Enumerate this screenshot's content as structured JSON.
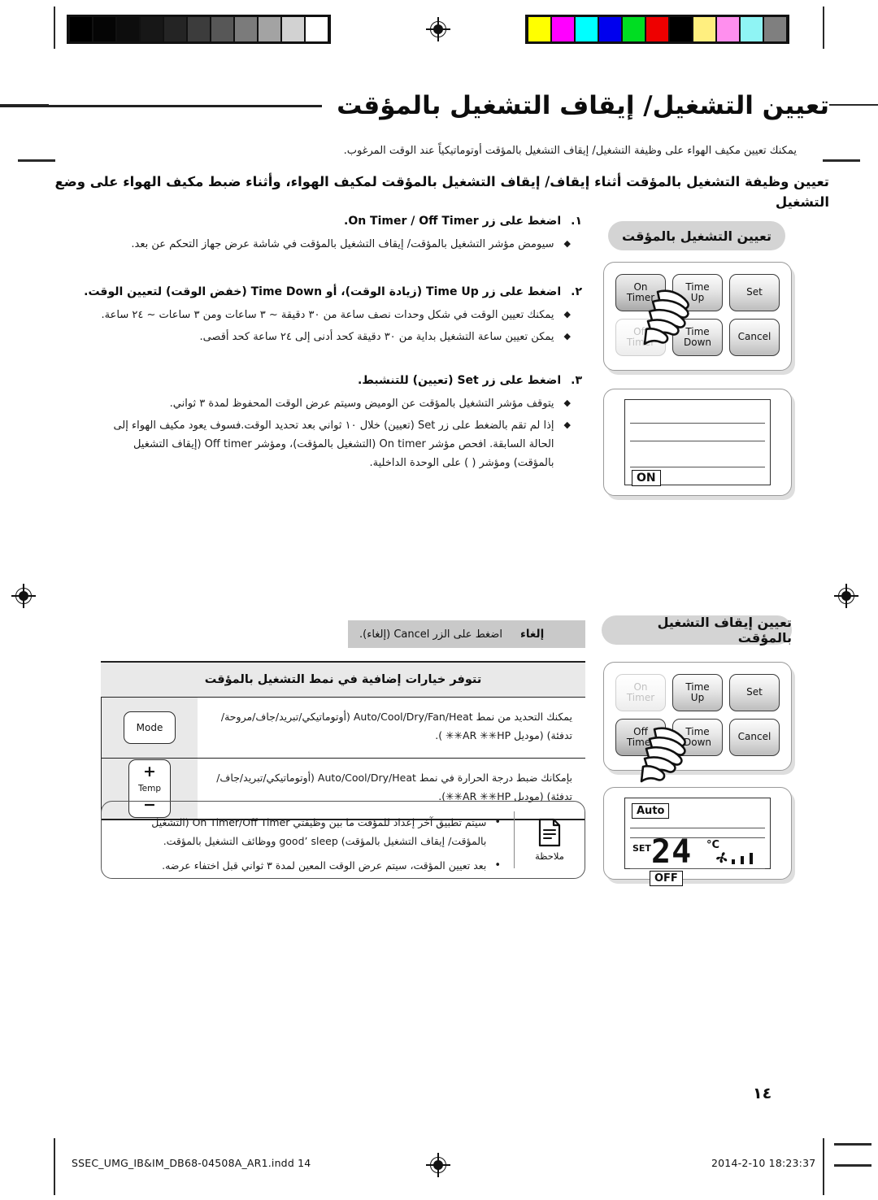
{
  "print_marks": {
    "grayscale_swatches": [
      "#000000",
      "#050505",
      "#0d0d0d",
      "#171717",
      "#242424",
      "#3c3c3c",
      "#575757",
      "#7b7b7b",
      "#a3a3a3",
      "#d2d2d2",
      "#ffffff"
    ],
    "color_swatches": [
      "#ffff00",
      "#ff00ff",
      "#00ffff",
      "#0000ee",
      "#00dd22",
      "#ee0000",
      "#000000",
      "#ffef7f",
      "#ff8fee",
      "#8ff4f4",
      "#7f7f7f"
    ],
    "registration_icon": "registration-target-icon"
  },
  "header": {
    "title": "تعيين التشغيل/ إيقاف التشغيل بالمؤقت",
    "lede": "يمكنك تعيين مكيف الهواء على وظيفة التشغيل/ إيقاف التشغيل بالمؤقت أوتوماتيكياً عند الوقت المرغوب.",
    "subhead": "تعيين وظيفة التشغيل بالمؤقت أثناء إيقاف/ إيقاف التشغيل بالمؤقت لمكيف الهواء، وأثناء ضبط مكيف الهواء على وضع التشغيل"
  },
  "steps": [
    {
      "num": "١.",
      "title_pre": "اضغط على زر ",
      "title_en": "On Timer / Off Timer",
      "title_post": ".",
      "bullets": [
        {
          "mark": "◆",
          "text": "سيومض مؤشر التشغيل بالمؤقت/ إيقاف التشغيل بالمؤقت في شاشة عرض جهاز التحكم عن بعد."
        }
      ]
    },
    {
      "num": "٢.",
      "title_full": "اضغط على زر Time Up (زيادة الوقت)، أو Time Down (خفض الوقت) لتعيين الوقت.",
      "bullets": [
        {
          "mark": "◆",
          "text": "يمكنك تعيين الوقت في شكل وحدات نصف ساعة من ٣٠ دقيقة ~ ٣ ساعات ومن ٣ ساعات ~ ٢٤ ساعة."
        },
        {
          "mark": "◆",
          "text": "يمكن تعيين ساعة التشغيل بداية من ٣٠ دقيقة كحد أدنى إلى ٢٤ ساعة كحد أقصى."
        }
      ]
    },
    {
      "num": "٣.",
      "title_full": "اضغط على زر Set (تعيين) للتنشبط.",
      "bullets": [
        {
          "mark": "◆",
          "text": "يتوقف مؤشر التشغيل بالمؤقت عن الوميض وسيتم عرض الوقت المحفوظ لمدة ٣ ثواني."
        },
        {
          "mark": "◆",
          "text": "إذا لم تقم بالضغط على زر Set (تعيين) خلال ١٠ ثواني بعد تحديد الوقت.فسوف يعود مكيف الهواء إلى الحالة السابقة. افحص مؤشر On timer (التشغيل بالمؤقت)، ومؤشر Off timer (إيقاف التشغيل بالمؤقت) ومؤشر ( ) على الوحدة الداخلية."
        }
      ]
    }
  ],
  "panels": [
    {
      "heading": "تعيين التشغيل بالمؤقت",
      "keys": [
        {
          "name": "on-timer",
          "line1": "On",
          "line2": "Timer",
          "state": "pressed"
        },
        {
          "name": "time-up",
          "line1": "Time",
          "line2": "Up",
          "state": "normal"
        },
        {
          "name": "set",
          "line1": "Set",
          "line2": "",
          "state": "normal"
        },
        {
          "name": "off-timer",
          "line1": "Off",
          "line2": "Timer",
          "state": "disabled"
        },
        {
          "name": "time-down",
          "line1": "Time",
          "line2": "Down",
          "state": "normal"
        },
        {
          "name": "cancel",
          "line1": "Cancel",
          "line2": "",
          "state": "normal"
        }
      ],
      "lcd": {
        "bottom_tag": "ON"
      }
    },
    {
      "heading": "تعيين إيقاف التشغيل بالمؤقت",
      "keys": [
        {
          "name": "on-timer",
          "line1": "On",
          "line2": "Timer",
          "state": "disabled"
        },
        {
          "name": "time-up",
          "line1": "Time",
          "line2": "Up",
          "state": "normal"
        },
        {
          "name": "set",
          "line1": "Set",
          "line2": "",
          "state": "normal"
        },
        {
          "name": "off-timer",
          "line1": "Off",
          "line2": "Timer",
          "state": "pressed"
        },
        {
          "name": "time-down",
          "line1": "Time",
          "line2": "Down",
          "state": "normal"
        },
        {
          "name": "cancel",
          "line1": "Cancel",
          "line2": "",
          "state": "normal"
        }
      ],
      "lcd": {
        "mode_tag": "Auto",
        "set_label": "SET",
        "temperature": "24",
        "unit": "°C",
        "fan_icon": "fan-icon",
        "fan_bars": 3,
        "bottom_tag": "OFF"
      }
    }
  ],
  "cancel_strip": {
    "label": "إلغاء",
    "text": "اضغط على الزر Cancel (إلغاء)."
  },
  "table": {
    "heading": "تتوفر خيارات إضافية في نمط التشغيل بالمؤقت",
    "rows": [
      {
        "button": {
          "name": "mode-button",
          "label": "Mode"
        },
        "text": "يمكنك التحديد من نمط Auto/Cool/Dry/Fan/Heat (أوتوماتيكي/تبريد/جاف/مروحة/ تدفئة) (موديل AR ✳✳HP✳✳ )."
      },
      {
        "button": {
          "name": "temp-button",
          "plus": "+",
          "label": "Temp",
          "minus": "−"
        },
        "text": "بإمكانك ضبط درجة الحرارة في نمط Auto/Cool/Dry/Heat (أوتوماتيكي/تبريد/جاف/ تدفئة) (موديل AR ✳✳HP✳✳)."
      }
    ]
  },
  "note": {
    "icon_label": "ملاحظة",
    "items": [
      {
        "bullet": "•",
        "text": "سيتم تطبيق آخر إعداد للمؤقت ما بين وظيفتي On Timer/Off Timer (التشغيل بالمؤقت/ إيقاف التشغيل بالمؤقت) good’ sleep ووظائف التشغيل بالمؤقت."
      },
      {
        "bullet": "•",
        "text": "بعد تعيين المؤقت، سيتم عرض الوقت المعين لمدة ٣ ثواني قبل اختفاء عرضه."
      }
    ]
  },
  "footer": {
    "page_number": "١٤",
    "file_name": "SSEC_UMG_IB&IM_DB68-04508A_AR1.indd   14",
    "timestamp": "2014-2-10   18:23:37"
  }
}
